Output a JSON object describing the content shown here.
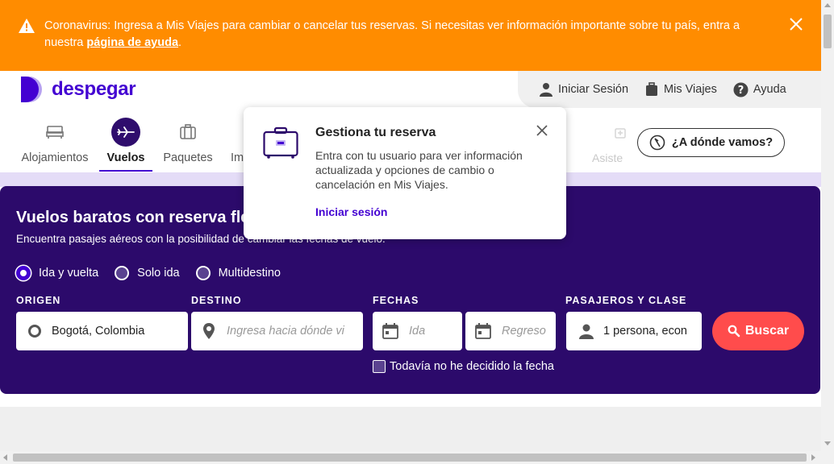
{
  "banner": {
    "text_before": "Coronavirus: Ingresa a Mis Viajes para cambiar o cancelar tus reservas. Si necesitas ver información importante sobre tu país, entra a nuestra ",
    "link": "página de ayuda",
    "text_after": ".",
    "bg_color": "#ff8c00"
  },
  "header": {
    "logo_text": "despegar",
    "brand_color": "#4300d2",
    "user_links": [
      {
        "label": "Iniciar Sesión",
        "icon": "user-icon"
      },
      {
        "label": "Mis Viajes",
        "icon": "suitcase-icon"
      },
      {
        "label": "Ayuda",
        "icon": "help-icon"
      }
    ]
  },
  "nav": {
    "items": [
      {
        "label": "Alojamientos",
        "icon": "bed-icon"
      },
      {
        "label": "Vuelos",
        "icon": "plane-icon",
        "active": true
      },
      {
        "label": "Paquetes",
        "icon": "luggage-icon"
      },
      {
        "label": "Im",
        "icon": "partial"
      }
    ],
    "faded_label": "Asiste",
    "where_button": "¿A dónde vamos?"
  },
  "popover": {
    "title": "Gestiona tu reserva",
    "body": "Entra con tu usuario para ver información actualizada y opciones de cambio o cancelación en Mis Viajes.",
    "link": "Iniciar sesión"
  },
  "search": {
    "title": "Vuelos baratos con reserva fle",
    "subtitle": "Encuentra pasajes aéreos con la posibilidad de cambiar las fechas de vuelo.",
    "trip_types": [
      "Ida y vuelta",
      "Solo ida",
      "Multidestino"
    ],
    "selected_trip_type": "Ida y vuelta",
    "labels": {
      "origin": "ORIGEN",
      "destination": "DESTINO",
      "dates": "FECHAS",
      "passengers": "PASAJEROS Y CLASE"
    },
    "origin_value": "Bogotá, Colombia",
    "destination_placeholder": "Ingresa hacia dónde vi",
    "depart_placeholder": "Ida",
    "return_placeholder": "Regreso",
    "passengers_value": "1 persona, econ",
    "search_button": "Buscar",
    "undecided_label": "Todavía no he decidido la fecha",
    "panel_color": "#2c0a6b",
    "button_color": "#ff4c4c"
  }
}
